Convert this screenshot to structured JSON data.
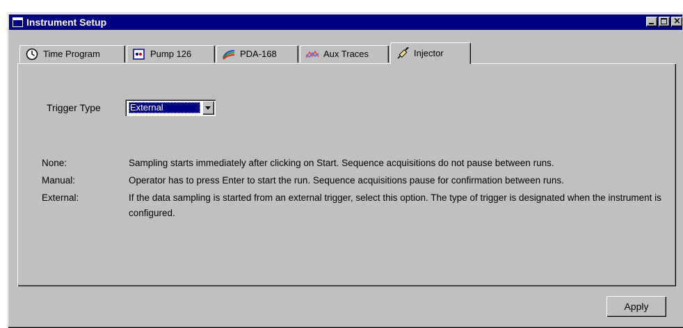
{
  "window": {
    "title": "Instrument Setup"
  },
  "tabs": [
    {
      "label": "Time Program",
      "icon": "clock-icon"
    },
    {
      "label": "Pump 126",
      "icon": "pump-icon"
    },
    {
      "label": "PDA-168",
      "icon": "spectrum-icon"
    },
    {
      "label": "Aux Traces",
      "icon": "aux-traces-icon"
    },
    {
      "label": "Injector",
      "icon": "syringe-icon",
      "active": true
    }
  ],
  "injector": {
    "trigger_label": "Trigger Type",
    "trigger_value": "External",
    "descriptions": [
      {
        "key": "None:",
        "text": "Sampling starts immediately after clicking on Start.  Sequence acquisitions do not pause between runs."
      },
      {
        "key": "Manual:",
        "text": "Operator has to press Enter to start the run.  Sequence acquisitions pause for confirmation between runs."
      },
      {
        "key": "External:",
        "text": "If the data sampling is started from an external trigger, select this option.  The type of trigger is designated when the instrument is configured."
      }
    ]
  },
  "footer": {
    "apply_label": "Apply"
  },
  "colors": {
    "titlebar": "#000080",
    "face": "#c0c0c0",
    "selection": "#000080"
  }
}
